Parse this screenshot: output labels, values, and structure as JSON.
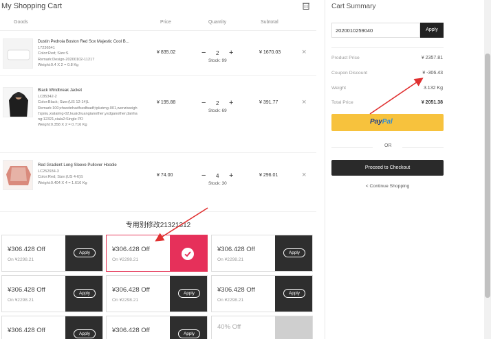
{
  "cart": {
    "title": "My Shopping Cart",
    "columns": {
      "goods": "Goods",
      "price": "Price",
      "quantity": "Quantity",
      "subtotal": "Subtotal"
    },
    "items": [
      {
        "name": "Dustin Pedroia Boston Red Sox Majestic Cool B...",
        "sku": "17236541",
        "color_size": "Color:Red; Size:S",
        "remark": "Remark:Design-20200102-11217",
        "remark2": "",
        "weight": "Weight:0.4 X 2 = 0.8 Kg",
        "price": "¥ 835.02",
        "qty": "2",
        "stock": "Stock: 99",
        "subtotal": "¥ 1670.03"
      },
      {
        "name": "Black Windbreak Jacket",
        "sku": "LC85342-2",
        "color_size": "Color:Black; Size:(US 12-14)L",
        "remark": "Remark:100;zhwebrhadfsedfsadf;tpkzimg-001,wenziweight'sjsku,xialaimg-02,kuaichuangianother,ysdganother,danhang:12321,xiala2:Single PD",
        "remark2": "",
        "weight": "Weight:0.358 X 2 = 0.716 Kg",
        "price": "¥ 195.88",
        "qty": "2",
        "stock": "Stock: 69",
        "subtotal": "¥ 391.77"
      },
      {
        "name": "Red Gradient Long Sleeve Pullover Hoodie",
        "sku": "LC252934-3",
        "color_size": "Color:Red; Size:(US 4-6)S",
        "remark": "",
        "remark2": "",
        "weight": "Weight:0.404 X 4 = 1.616 Kg",
        "price": "¥ 74.00",
        "qty": "4",
        "stock": "Stock: 30",
        "subtotal": "¥ 296.01"
      }
    ],
    "qty_minus": "−",
    "qty_plus": "+",
    "remove": "×"
  },
  "coupons": {
    "title": "专用别修改21321312",
    "apply_label": "Apply",
    "items": [
      {
        "amount": "¥306.428 Off",
        "on": "On ¥2298.21",
        "state": "apply"
      },
      {
        "amount": "¥306.428 Off",
        "on": "On ¥2298.21",
        "state": "selected"
      },
      {
        "amount": "¥306.428 Off",
        "on": "On ¥2298.21",
        "state": "apply"
      },
      {
        "amount": "¥306.428 Off",
        "on": "On ¥2298.21",
        "state": "apply"
      },
      {
        "amount": "¥306.428 Off",
        "on": "On ¥2298.21",
        "state": "apply"
      },
      {
        "amount": "¥306.428 Off",
        "on": "On ¥2298.21",
        "state": "apply"
      },
      {
        "amount": "¥306.428 Off",
        "on": "",
        "state": "apply"
      },
      {
        "amount": "¥306.428 Off",
        "on": "",
        "state": "apply"
      },
      {
        "amount": "40% Off",
        "on": "",
        "state": "disabled"
      }
    ]
  },
  "summary": {
    "title": "Cart Summary",
    "code_value": "2020010259040",
    "apply_label": "Apply",
    "product_price_label": "Product Price",
    "product_price": "¥ 2357.81",
    "coupon_discount_label": "Coupon Discount",
    "coupon_discount": "¥ -306.43",
    "weight_label": "Weight",
    "weight": "3.132 Kg",
    "total_label": "Total Price",
    "total": "¥ 2051.38",
    "paypal_pay": "Pay",
    "paypal_pal": "Pal",
    "or": "OR",
    "checkout": "Proceed to Checkout",
    "continue": "< Continue Shopping"
  },
  "colors": {
    "annotation_arrow": "#e03030",
    "paypal_bg": "#f7c23d",
    "selected_coupon": "#e6305a",
    "dark_button": "#2a2a2a"
  }
}
